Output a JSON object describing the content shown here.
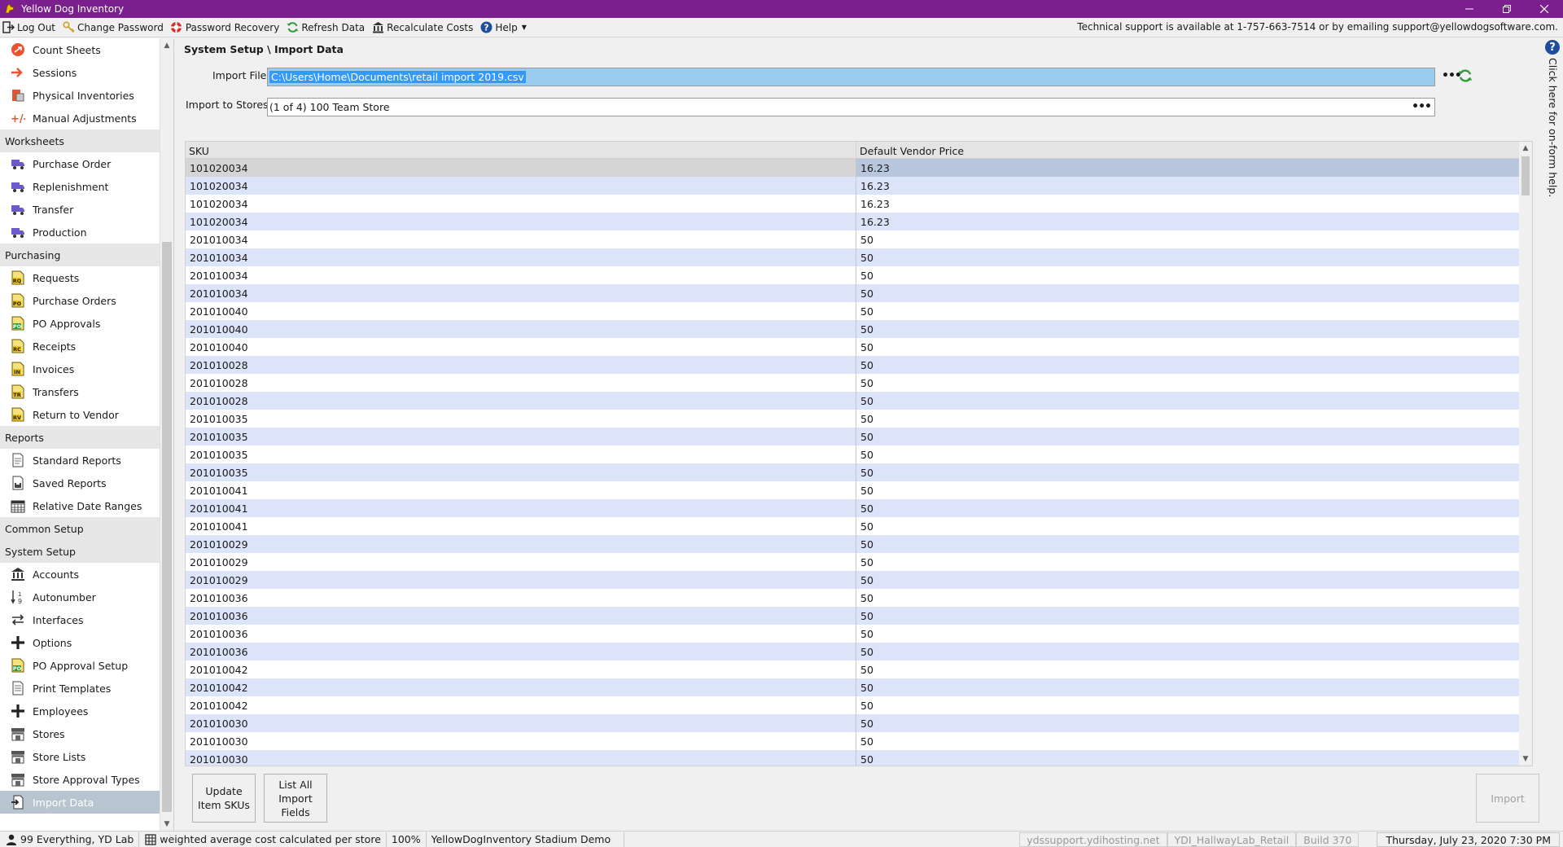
{
  "window": {
    "title": "Yellow Dog Inventory",
    "controls": [
      "minimize",
      "restore",
      "close"
    ]
  },
  "toolbar": {
    "items": [
      {
        "label": "Log Out",
        "icon": "log-out-icon"
      },
      {
        "label": "Change Password",
        "icon": "key-icon"
      },
      {
        "label": "Password Recovery",
        "icon": "lifebuoy-icon"
      },
      {
        "label": "Refresh Data",
        "icon": "refresh-icon"
      },
      {
        "label": "Recalculate Costs",
        "icon": "bank-icon"
      },
      {
        "label": "Help",
        "icon": "help-icon"
      }
    ],
    "support_text": "Technical support is available at 1-757-663-7514 or by emailing support@yellowdogsoftware.com."
  },
  "sidebar": {
    "items": [
      {
        "type": "item",
        "label": "Count Sheets",
        "icon": "count-sheets-icon"
      },
      {
        "type": "item",
        "label": "Sessions",
        "icon": "sessions-icon"
      },
      {
        "type": "item",
        "label": "Physical Inventories",
        "icon": "physical-inventories-icon"
      },
      {
        "type": "item",
        "label": "Manual Adjustments",
        "icon": "plus-minus-icon"
      },
      {
        "type": "header",
        "label": "Worksheets"
      },
      {
        "type": "item",
        "label": "Purchase Order",
        "icon": "truck-icon"
      },
      {
        "type": "item",
        "label": "Replenishment",
        "icon": "truck-icon"
      },
      {
        "type": "item",
        "label": "Transfer",
        "icon": "truck-icon"
      },
      {
        "type": "item",
        "label": "Production",
        "icon": "truck-icon"
      },
      {
        "type": "header",
        "label": "Purchasing"
      },
      {
        "type": "item",
        "label": "Requests",
        "icon": "doc-rq-icon",
        "badge": "RQ"
      },
      {
        "type": "item",
        "label": "Purchase Orders",
        "icon": "doc-po-icon",
        "badge": "PO"
      },
      {
        "type": "item",
        "label": "PO Approvals",
        "icon": "doc-po-approval-icon",
        "badge": "PO"
      },
      {
        "type": "item",
        "label": "Receipts",
        "icon": "doc-rc-icon",
        "badge": "RC"
      },
      {
        "type": "item",
        "label": "Invoices",
        "icon": "doc-in-icon",
        "badge": "IN"
      },
      {
        "type": "item",
        "label": "Transfers",
        "icon": "doc-tr-icon",
        "badge": "TR"
      },
      {
        "type": "item",
        "label": "Return to Vendor",
        "icon": "doc-rv-icon",
        "badge": "RV"
      },
      {
        "type": "header",
        "label": "Reports"
      },
      {
        "type": "item",
        "label": "Standard Reports",
        "icon": "report-icon"
      },
      {
        "type": "item",
        "label": "Saved Reports",
        "icon": "saved-report-icon"
      },
      {
        "type": "item",
        "label": "Relative Date Ranges",
        "icon": "calendar-icon"
      },
      {
        "type": "header",
        "label": "Common Setup"
      },
      {
        "type": "header",
        "label": "System Setup"
      },
      {
        "type": "item",
        "label": "Accounts",
        "icon": "bank-icon"
      },
      {
        "type": "item",
        "label": "Autonumber",
        "icon": "autonumber-icon"
      },
      {
        "type": "item",
        "label": "Interfaces",
        "icon": "arrows-icon"
      },
      {
        "type": "item",
        "label": "Options",
        "icon": "options-icon"
      },
      {
        "type": "item",
        "label": "PO Approval Setup",
        "icon": "doc-po-approval-icon",
        "badge": "PO"
      },
      {
        "type": "item",
        "label": "Print Templates",
        "icon": "print-template-icon"
      },
      {
        "type": "item",
        "label": "Employees",
        "icon": "employees-icon"
      },
      {
        "type": "item",
        "label": "Stores",
        "icon": "store-icon"
      },
      {
        "type": "item",
        "label": "Store Lists",
        "icon": "store-icon"
      },
      {
        "type": "item",
        "label": "Store Approval Types",
        "icon": "store-icon"
      },
      {
        "type": "item",
        "label": "Import Data",
        "icon": "import-icon",
        "selected": true
      }
    ]
  },
  "main": {
    "breadcrumb": "System Setup \\ Import Data",
    "import_file_label": "Import File",
    "import_file_value": "C:\\Users\\Home\\Documents\\retail import 2019.csv",
    "import_stores_label": "Import to Stores",
    "import_stores_value": "(1 of 4) 100 Team Store",
    "grid": {
      "columns": [
        "SKU",
        "Default Vendor Price"
      ],
      "rows": [
        [
          "101020034",
          "16.23"
        ],
        [
          "101020034",
          "16.23"
        ],
        [
          "101020034",
          "16.23"
        ],
        [
          "101020034",
          "16.23"
        ],
        [
          "201010034",
          "50"
        ],
        [
          "201010034",
          "50"
        ],
        [
          "201010034",
          "50"
        ],
        [
          "201010034",
          "50"
        ],
        [
          "201010040",
          "50"
        ],
        [
          "201010040",
          "50"
        ],
        [
          "201010040",
          "50"
        ],
        [
          "201010028",
          "50"
        ],
        [
          "201010028",
          "50"
        ],
        [
          "201010028",
          "50"
        ],
        [
          "201010035",
          "50"
        ],
        [
          "201010035",
          "50"
        ],
        [
          "201010035",
          "50"
        ],
        [
          "201010035",
          "50"
        ],
        [
          "201010041",
          "50"
        ],
        [
          "201010041",
          "50"
        ],
        [
          "201010041",
          "50"
        ],
        [
          "201010029",
          "50"
        ],
        [
          "201010029",
          "50"
        ],
        [
          "201010029",
          "50"
        ],
        [
          "201010036",
          "50"
        ],
        [
          "201010036",
          "50"
        ],
        [
          "201010036",
          "50"
        ],
        [
          "201010036",
          "50"
        ],
        [
          "201010042",
          "50"
        ],
        [
          "201010042",
          "50"
        ],
        [
          "201010042",
          "50"
        ],
        [
          "201010030",
          "50"
        ],
        [
          "201010030",
          "50"
        ],
        [
          "201010030",
          "50"
        ]
      ]
    },
    "buttons": {
      "update_item_skus": "Update Item SKUs",
      "list_all_import_fields": "List All Import Fields",
      "import": "Import"
    }
  },
  "help_strip": {
    "text": "Click here for on-form help."
  },
  "statusbar": {
    "user": "99 Everything, YD Lab",
    "cost_mode": "weighted average cost calculated per store",
    "zoom": "100%",
    "database": "YellowDogInventory Stadium Demo",
    "server": "ydssupport.ydihosting.net",
    "location": "YDI_HallwayLab_Retail",
    "build": "Build 370",
    "datetime": "Thursday, July 23, 2020 7:30 PM"
  },
  "colors": {
    "titlebar": "#7b1e8e",
    "row_alt": "#dce4fa",
    "selection": "#3399ff"
  }
}
